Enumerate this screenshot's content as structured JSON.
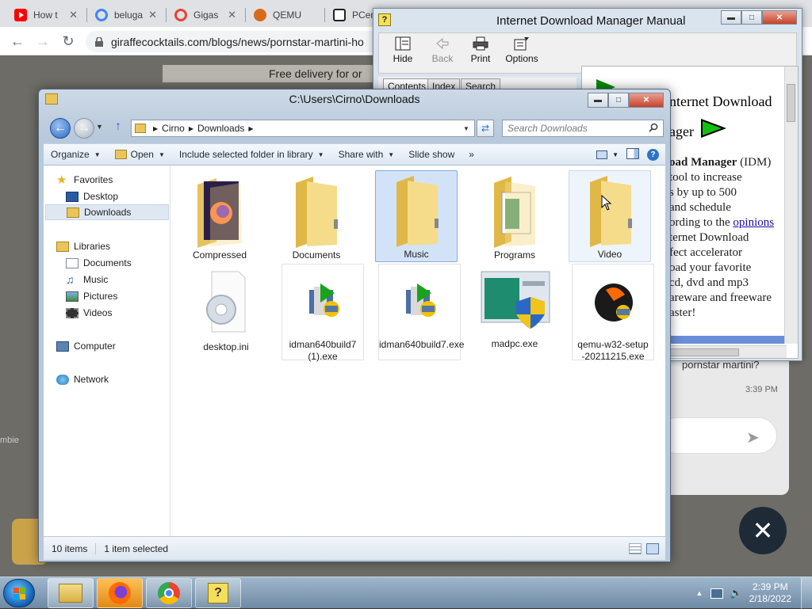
{
  "browser": {
    "tabs": [
      {
        "label": "How t",
        "favicon": "youtube-icon",
        "color": "#ff0000"
      },
      {
        "label": "beluga",
        "favicon": "google-icon",
        "color": "#4285f4"
      },
      {
        "label": "Gigas",
        "favicon": "google-icon",
        "color": "#e94235"
      },
      {
        "label": "QEMU",
        "favicon": "qemu-icon",
        "color": "#d86b1a"
      },
      {
        "label": "PCem",
        "favicon": "pcem-icon",
        "color": "#222222"
      }
    ],
    "tab_close": "✕",
    "url": "giraffecocktails.com/blogs/news/pornstar-martini-ho",
    "page_banner": "Free delivery for or",
    "page_chat_message": "pornstar martini?",
    "page_chat_time": "3:39 PM",
    "page_fragment": "mbie"
  },
  "help_window": {
    "title": "Internet Download Manager Manual",
    "toolbar": [
      {
        "label": "Hide",
        "icon": "hide-icon",
        "enabled": true
      },
      {
        "label": "Back",
        "icon": "back-icon",
        "enabled": false
      },
      {
        "label": "Print",
        "icon": "print-icon",
        "enabled": true
      },
      {
        "label": "Options",
        "icon": "options-icon",
        "enabled": true
      }
    ],
    "tabs": [
      "Contents",
      "Index",
      "Search"
    ],
    "heading_line1": "nternet Download",
    "heading_line2": "ager",
    "body_bold": "oad Manager",
    "body_bold_suffix": " (IDM)",
    "body_lines": [
      "tool to increase",
      "s by up to 500",
      "and schedule",
      "ording to the "
    ],
    "body_link": "opinions",
    "body_lines2": [
      "ternet Download",
      "fect accelerator",
      "oad your favorite",
      "cd, dvd and mp3",
      "areware and freeware",
      "aster!"
    ]
  },
  "explorer": {
    "title": "C:\\Users\\Cirno\\Downloads",
    "breadcrumbs": [
      "Cirno",
      "Downloads"
    ],
    "search_placeholder": "Search Downloads",
    "commands": {
      "organize": "Organize",
      "open": "Open",
      "include": "Include selected folder in library",
      "share": "Share with",
      "slideshow": "Slide show",
      "more": "»"
    },
    "nav": {
      "favorites": "Favorites",
      "desktop": "Desktop",
      "downloads": "Downloads",
      "libraries": "Libraries",
      "documents": "Documents",
      "music": "Music",
      "pictures": "Pictures",
      "videos": "Videos",
      "computer": "Computer",
      "network": "Network"
    },
    "files": [
      {
        "name": "Compressed",
        "type": "folder",
        "icon": "firefox-folder-icon"
      },
      {
        "name": "Documents",
        "type": "folder",
        "icon": "folder-icon"
      },
      {
        "name": "Music",
        "type": "folder",
        "icon": "folder-icon",
        "state": "selected"
      },
      {
        "name": "Programs",
        "type": "folder",
        "icon": "programs-folder-icon"
      },
      {
        "name": "Video",
        "type": "folder",
        "icon": "folder-icon",
        "state": "hover"
      },
      {
        "name": "desktop.ini",
        "type": "file",
        "icon": "settings-file-icon"
      },
      {
        "name": "idman640build7 (1).exe",
        "type": "file",
        "icon": "installer-icon"
      },
      {
        "name": "idman640build7.exe",
        "type": "file",
        "icon": "installer-icon"
      },
      {
        "name": "madpc.exe",
        "type": "file",
        "icon": "shield-window-icon"
      },
      {
        "name": "qemu-w32-setup -20211215.exe",
        "type": "file",
        "icon": "qemu-setup-icon"
      }
    ],
    "status": {
      "items": "10 items",
      "selected": "1 item selected"
    }
  },
  "taskbar": {
    "time": "2:39 PM",
    "date": "2/18/2022",
    "apps": [
      "explorer-icon",
      "firefox-icon",
      "chrome-icon",
      "help-icon"
    ]
  },
  "colors": {
    "selected_bg": "#d3e3f7",
    "folder": "#f2d77c",
    "link": "#1a0dab"
  }
}
